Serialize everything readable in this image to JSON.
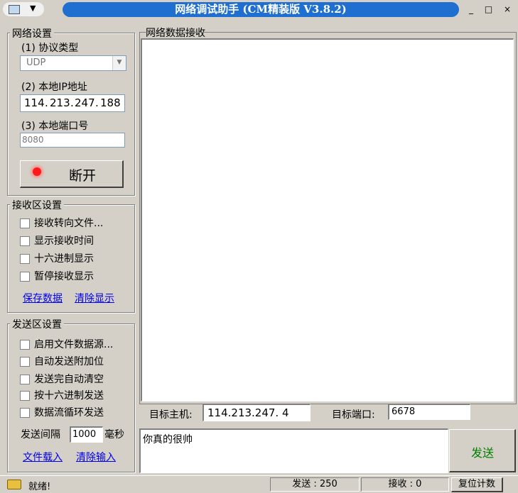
{
  "window": {
    "title": "网络调试助手 (CM精装版 V3.8.2)",
    "controls": "_ □ ×"
  },
  "network": {
    "legend": "网络设置",
    "protocol_label": "(1) 协议类型",
    "protocol_value": "UDP",
    "ip_label": "(2) 本地IP地址",
    "ip_octets": [
      "114",
      "213",
      "247",
      "188"
    ],
    "port_label": "(3) 本地端口号",
    "port_value": "8080",
    "disconnect_label": "断开"
  },
  "receive": {
    "legend": "接收区设置",
    "options": [
      "接收转向文件...",
      "显示接收时间",
      "十六进制显示",
      "暂停接收显示"
    ],
    "save_link": "保存数据",
    "clear_link": "清除显示"
  },
  "send": {
    "legend": "发送区设置",
    "options": [
      "启用文件数据源...",
      "自动发送附加位",
      "发送完自动清空",
      "按十六进制发送",
      "数据流循环发送"
    ],
    "interval_label": "发送间隔",
    "interval_value": "1000",
    "interval_unit": "毫秒",
    "load_link": "文件载入",
    "clear_link": "清除输入"
  },
  "receive_area": {
    "legend": "网络数据接收"
  },
  "target": {
    "host_label": "目标主机:",
    "host_value": "114.213.247. 4",
    "port_label": "目标端口:",
    "port_value": "6678"
  },
  "message": {
    "text": "你真的很帅"
  },
  "send_button": "发送",
  "status": {
    "ready": "就绪!",
    "sent": "发送 : 250",
    "received": "接收 : 0",
    "reset": "复位计数"
  },
  "colors": {
    "title_bar": "#1f6fd0",
    "send_button_text": "#008000",
    "link": "#0000ee"
  }
}
